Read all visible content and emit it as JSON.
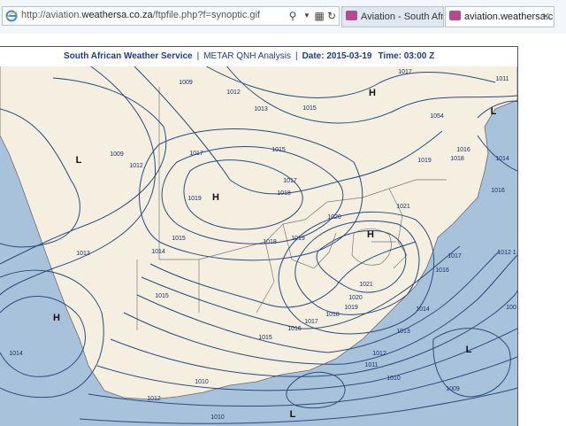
{
  "browser": {
    "url_prefix": "http://aviation.",
    "url_domain": "weathersa.co.za",
    "url_suffix": "/ftpfile.php?f=synoptic.gif",
    "tabs": [
      {
        "label": "Aviation - South Africa..."
      },
      {
        "label": "aviation.weathersa.c..."
      }
    ]
  },
  "header": {
    "org": "South African Weather Service",
    "product": "METAR QNH Analysis",
    "date_label": "Date: 2015-03-19",
    "time_label": "Time: 03:00 Z",
    "separator": "|"
  },
  "map": {
    "pressure_labels": [
      "1009",
      "1012",
      "1013",
      "1015",
      "1016",
      "1017",
      "1011",
      "1014",
      "1019",
      "1018",
      "1020",
      "1021",
      "1010",
      "1012",
      "1013",
      "1014",
      "1015",
      "1016",
      "1017",
      "1018",
      "1019",
      "1009",
      "1010",
      "1011",
      "1012",
      "1013",
      "1014",
      "1015",
      "1016",
      "1017",
      "1018",
      "1019",
      "1020",
      "1021",
      "1012",
      "1011",
      "1009",
      "1010",
      "1010",
      "1011",
      "1012",
      "1013",
      "1014",
      "1015",
      "1016",
      "1017",
      "1018",
      "1019",
      "1020",
      "1021",
      "1012 1",
      "100"
    ],
    "centers": [
      {
        "type": "H"
      },
      {
        "type": "H"
      },
      {
        "type": "H"
      },
      {
        "type": "H"
      },
      {
        "type": "L"
      },
      {
        "type": "L"
      },
      {
        "type": "L"
      },
      {
        "type": "L"
      }
    ]
  },
  "colors": {
    "ocean": "#a9c2dc",
    "land": "#f4efe1",
    "isobar": "#2c4b7a",
    "header_text": "#1f3a8a"
  }
}
